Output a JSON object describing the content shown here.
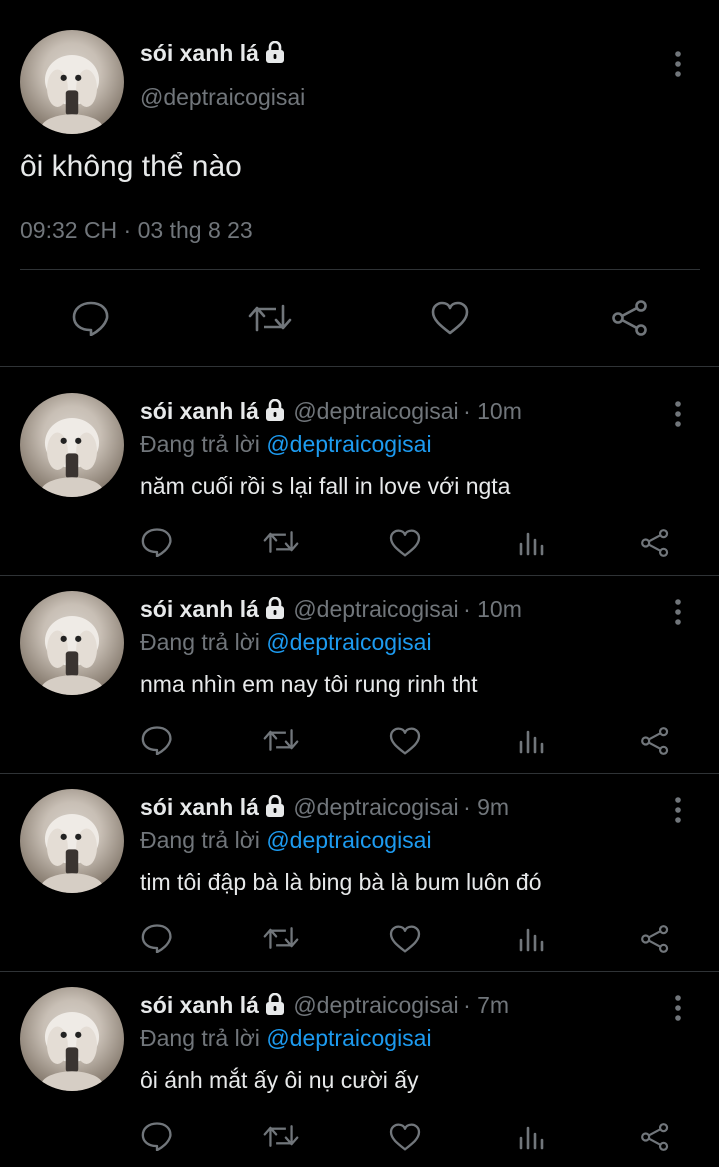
{
  "main_tweet": {
    "name": "sói xanh lá",
    "handle": "@deptraicogisai",
    "text": "ôi không thể nào",
    "timestamp": "09:32 CH · 03 thg 8 23"
  },
  "replies": [
    {
      "name": "sói xanh lá",
      "handle": "@deptraicogisai",
      "time": "· 10m",
      "replying_prefix": "Đang trả lời ",
      "replying_to": "@deptraicogisai",
      "text": "năm cuối rồi s lại fall in love với ngta"
    },
    {
      "name": "sói xanh lá",
      "handle": "@deptraicogisai",
      "time": "· 10m",
      "replying_prefix": "Đang trả lời ",
      "replying_to": "@deptraicogisai",
      "text": "nma nhìn em nay tôi rung rinh tht"
    },
    {
      "name": "sói xanh lá",
      "handle": "@deptraicogisai",
      "time": "· 9m",
      "replying_prefix": "Đang trả lời ",
      "replying_to": "@deptraicogisai",
      "text": "tim tôi đập bà là bing bà là bum luôn đó"
    },
    {
      "name": "sói xanh lá",
      "handle": "@deptraicogisai",
      "time": "· 7m",
      "replying_prefix": "Đang trả lời ",
      "replying_to": "@deptraicogisai",
      "text": "ôi ánh mắt ấy ôi nụ cười ấy"
    }
  ],
  "colors": {
    "background": "#000000",
    "text": "#e7e9ea",
    "muted": "#71767b",
    "link": "#1d9bf0",
    "divider": "#2f3336"
  },
  "icons": [
    "lock-icon",
    "more-icon",
    "reply-icon",
    "retweet-icon",
    "like-icon",
    "views-icon",
    "share-icon"
  ]
}
